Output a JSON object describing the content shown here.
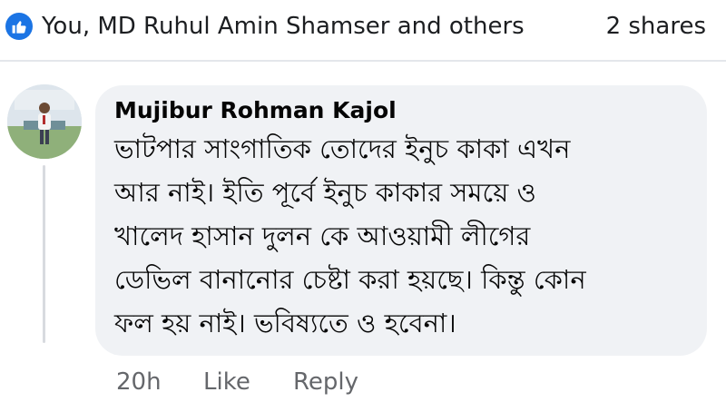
{
  "reactions": {
    "icon": "like-icon",
    "accent": "#1b74e4",
    "reactors_text": "You, MD Ruhul Amin Shamser and others",
    "shares_text": "2 shares"
  },
  "comment": {
    "author": "Mujibur Rohman Kajol",
    "lines": [
      "ভাটপার সাংগাতিক তোদের ইনুচ কাকা এখন",
      "আর নাই। ইতি পূর্বে ইনুচ কাকার সময়ে ও",
      "খালেদ হাসান দুলন কে আওয়ামী লীগের",
      "ডেভিল বানানোর চেষ্টা করা হয়ছে। কিন্তু কোন",
      "ফল হয় নাই। ভবিষ্যতে ও হবেনা।"
    ],
    "actions": {
      "time": "20h",
      "like": "Like",
      "reply": "Reply"
    }
  }
}
